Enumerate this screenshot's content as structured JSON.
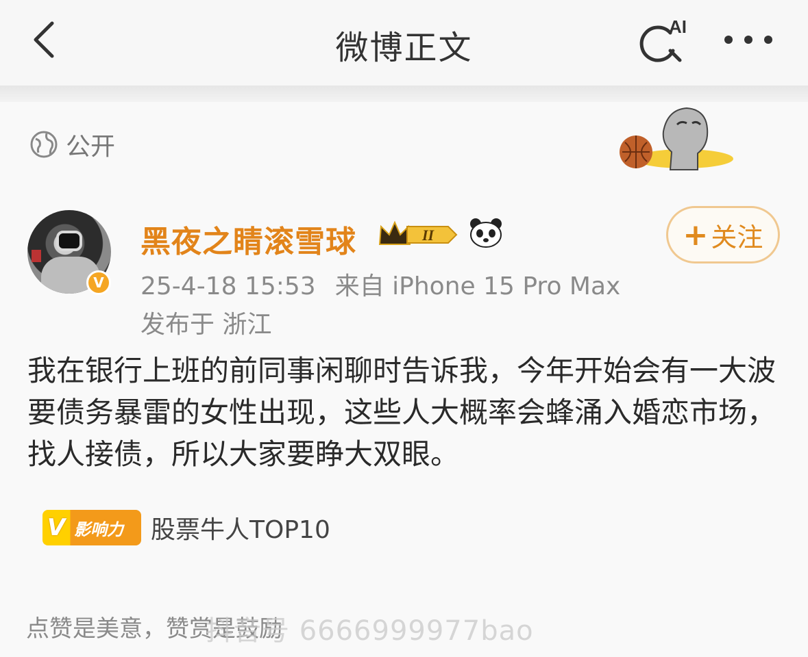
{
  "header": {
    "title": "微博正文",
    "ai_label": "AI"
  },
  "post": {
    "visibility": "公开",
    "author": {
      "name": "黑夜之睛滚雪球",
      "level_badge": "II",
      "verified_mark": "V"
    },
    "timestamp": "25-4-18 15:53",
    "source": "来自 iPhone 15 Pro Max",
    "location": "发布于 浙江",
    "follow_label": "关注",
    "follow_plus": "+",
    "text": "我在银行上班的前同事闲聊时告诉我，今年开始会有一大波要债务暴雷的女性出现，这些人大概率会蜂涌入婚恋市场，找人接债，所以大家要睁大双眼。",
    "influence_badge_v": "V",
    "influence_badge_text": "影响力",
    "influence_label": "股票牛人TOP10",
    "like_hint": "点赞是美意，赞赏是鼓励"
  },
  "watermark": "抖音号 6666999977bao",
  "colors": {
    "username": "#e2841a",
    "follow_border": "#f0c890",
    "meta_text": "#8a8a8a"
  },
  "icons": [
    "back-icon",
    "ai-search-icon",
    "more-icon",
    "globe-icon",
    "crown-badge-icon",
    "panda-icon"
  ]
}
